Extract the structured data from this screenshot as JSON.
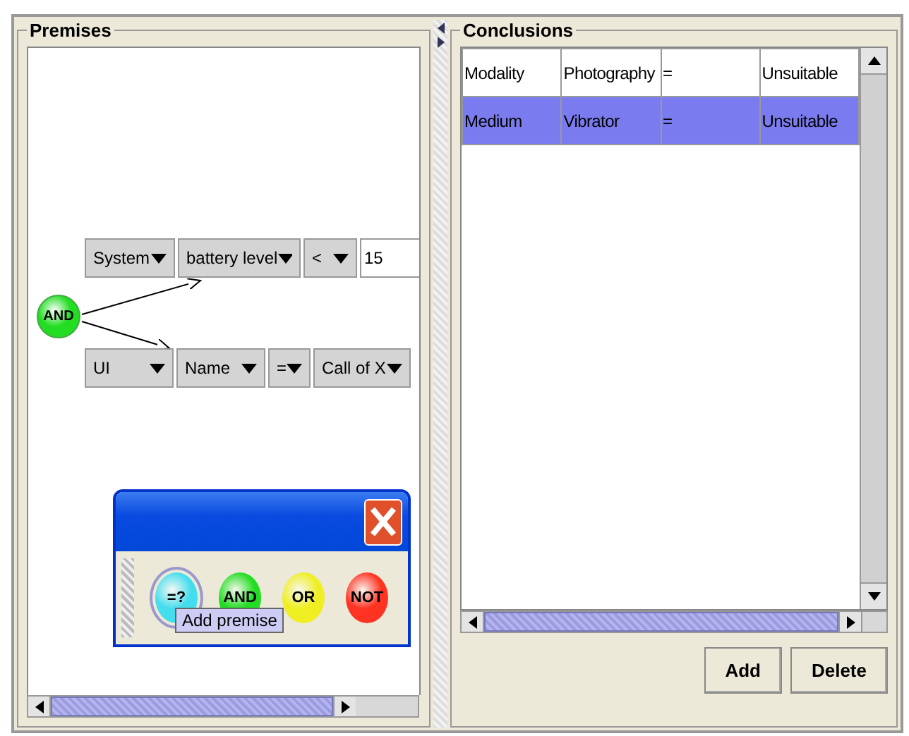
{
  "premises": {
    "title": "Premises",
    "root_node": {
      "label": "AND",
      "color": "#22dd22"
    },
    "conditions": [
      {
        "fields": [
          {
            "kind": "dropdown",
            "value": "System"
          },
          {
            "kind": "dropdown",
            "value": "battery level"
          },
          {
            "kind": "dropdown",
            "value": "<"
          },
          {
            "kind": "input",
            "value": "15"
          }
        ]
      },
      {
        "fields": [
          {
            "kind": "dropdown",
            "value": "UI"
          },
          {
            "kind": "dropdown",
            "value": "Name"
          },
          {
            "kind": "dropdown",
            "value": "="
          },
          {
            "kind": "dropdown",
            "value": "Call of X"
          }
        ]
      }
    ],
    "palette": {
      "buttons": [
        {
          "label": "=?",
          "color": "#44ddee",
          "selected": true
        },
        {
          "label": "AND",
          "color": "#22dd22",
          "selected": false
        },
        {
          "label": "OR",
          "color": "#eeee22",
          "selected": false
        },
        {
          "label": "NOT",
          "color": "#ff3322",
          "selected": false
        }
      ],
      "tooltip": "Add premise"
    }
  },
  "conclusions": {
    "title": "Conclusions",
    "rows": [
      {
        "cells": [
          "Modality",
          "Photography",
          "=",
          "Unsuitable"
        ],
        "selected": false
      },
      {
        "cells": [
          "Medium",
          "Vibrator",
          "=",
          "Unsuitable"
        ],
        "selected": true
      }
    ],
    "buttons": [
      "Add",
      "Delete"
    ]
  }
}
